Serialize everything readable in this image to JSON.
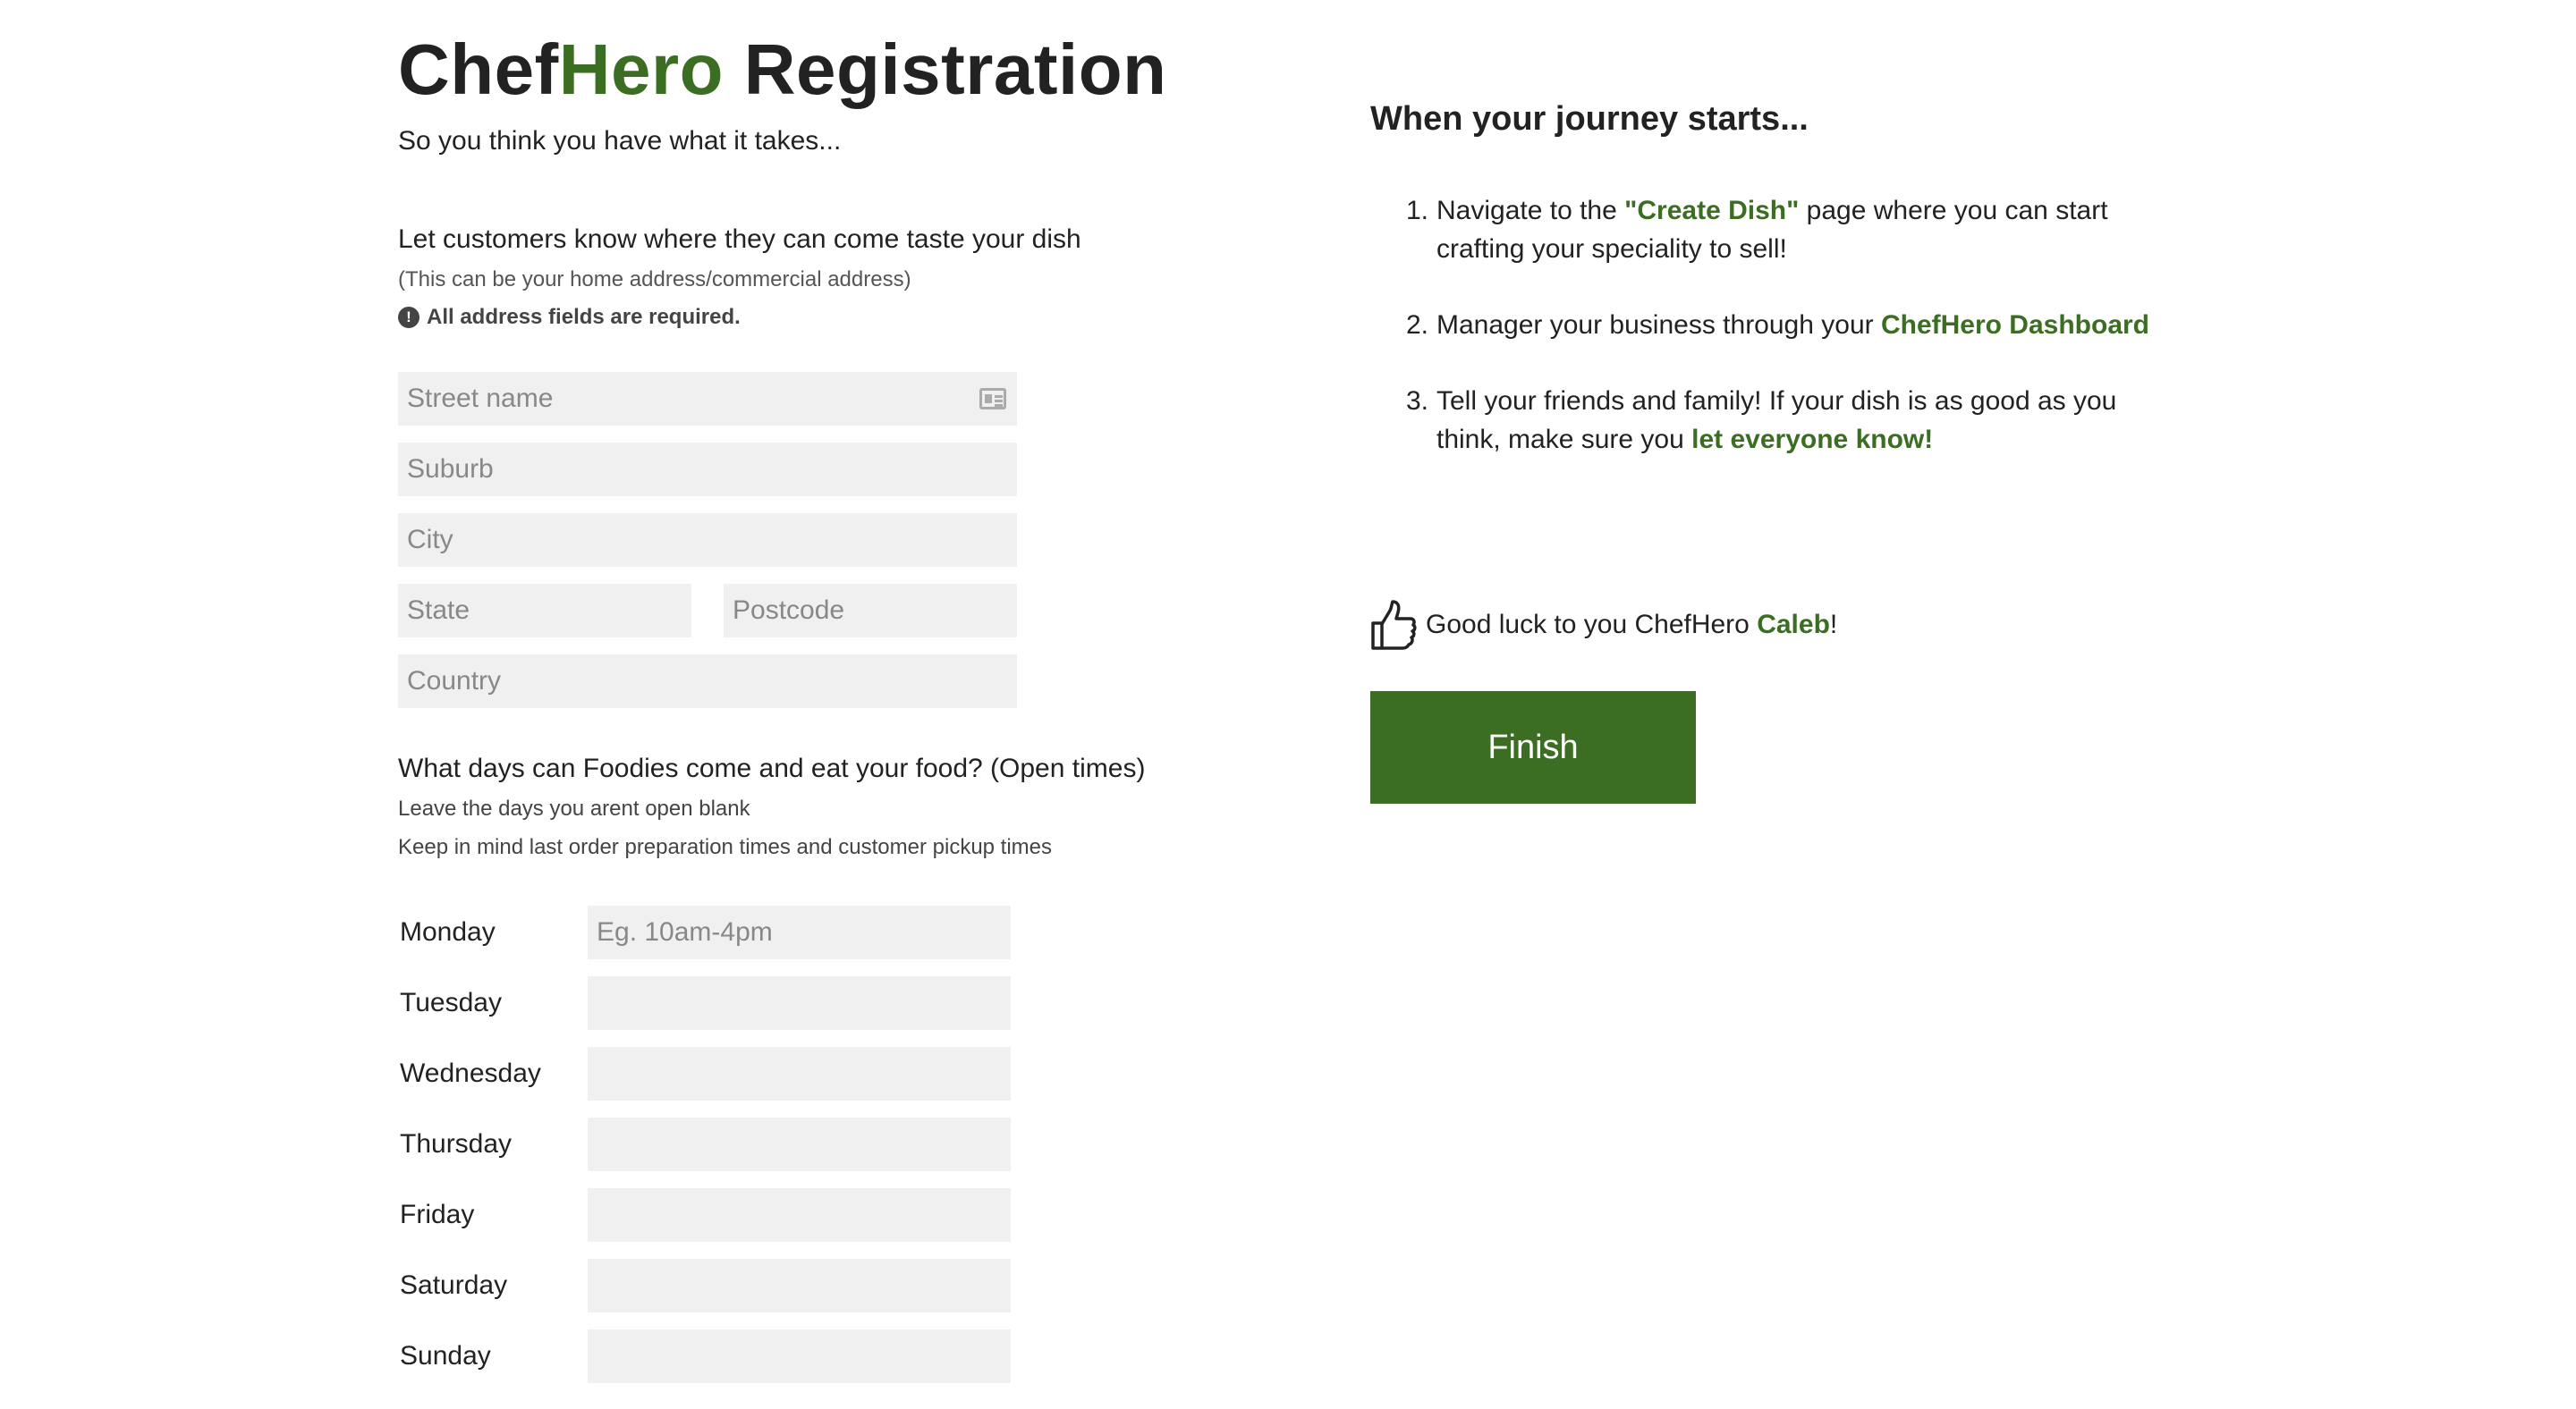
{
  "header": {
    "title_prefix": "Chef",
    "title_brand": "Hero",
    "title_suffix": " Registration",
    "subtitle": "So you think you have what it takes..."
  },
  "address": {
    "heading": "Let customers know where they can come taste your dish",
    "note": "(This can be your home address/commercial address)",
    "required_icon": "exclamation-circle-icon",
    "required_text": "All address fields are required.",
    "street_placeholder": "Street name",
    "street_icon": "address-card-icon",
    "suburb_placeholder": "Suburb",
    "city_placeholder": "City",
    "state_placeholder": "State",
    "postcode_placeholder": "Postcode",
    "country_placeholder": "Country"
  },
  "hours": {
    "heading": "What days can Foodies come and eat your food? (Open times)",
    "note_1": "Leave the days you arent open blank",
    "note_2": "Keep in mind last order preparation times and customer pickup times",
    "days": [
      {
        "label": "Monday",
        "placeholder": "Eg. 10am-4pm"
      },
      {
        "label": "Tuesday",
        "placeholder": ""
      },
      {
        "label": "Wednesday",
        "placeholder": ""
      },
      {
        "label": "Thursday",
        "placeholder": ""
      },
      {
        "label": "Friday",
        "placeholder": ""
      },
      {
        "label": "Saturday",
        "placeholder": ""
      },
      {
        "label": "Sunday",
        "placeholder": ""
      }
    ]
  },
  "journey": {
    "heading": "When your journey starts...",
    "steps": [
      {
        "num": "1.",
        "pre": "Navigate to the ",
        "highlight": "\"Create Dish\"",
        "post": " page where you can start crafting your speciality to sell!"
      },
      {
        "num": "2.",
        "pre": "Manager your business through your ",
        "highlight": "ChefHero Dashboard",
        "post": ""
      },
      {
        "num": "3.",
        "pre": "Tell your friends and family! If your dish is as good as you think, make sure you ",
        "highlight": "let everyone know!",
        "post": ""
      }
    ]
  },
  "footer": {
    "luck_icon": "thumbs-up-icon",
    "luck_pre": "Good luck to you ChefHero ",
    "luck_name": "Caleb",
    "luck_post": "!",
    "finish_label": "Finish"
  },
  "colors": {
    "brand_green": "#3b6e22",
    "input_bg": "#f0f0f0",
    "text": "#222222"
  }
}
